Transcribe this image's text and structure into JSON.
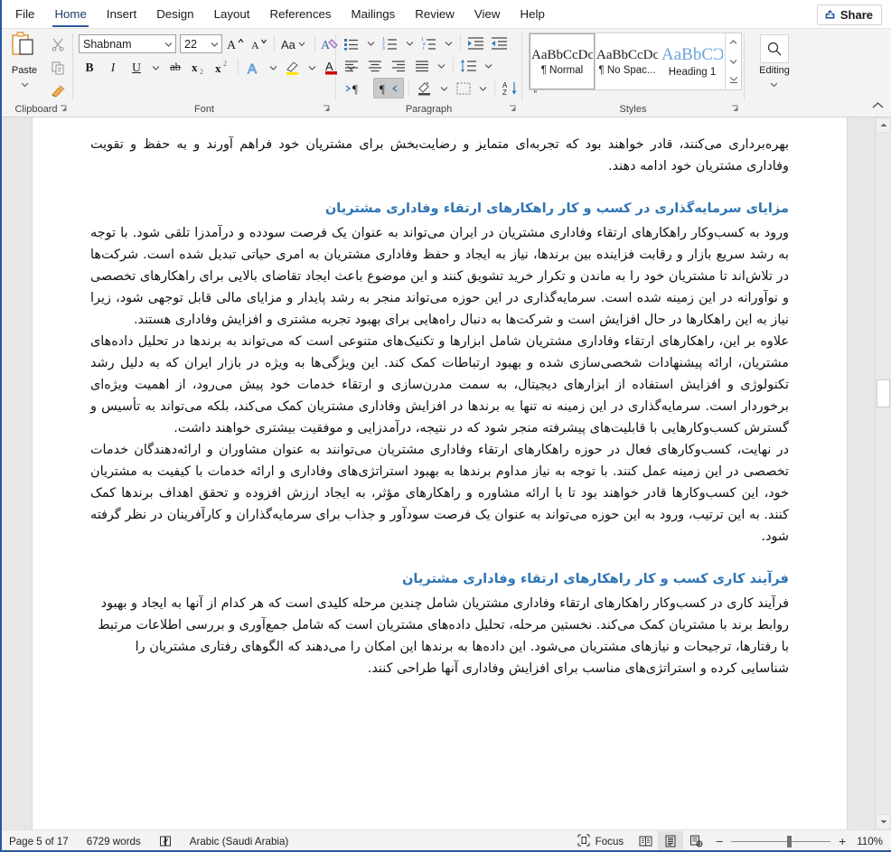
{
  "window": {
    "accent_color": "#2b579a",
    "share_label": "Share"
  },
  "ribbon_tabs": [
    {
      "label": "File",
      "active": false
    },
    {
      "label": "Home",
      "active": true
    },
    {
      "label": "Insert",
      "active": false
    },
    {
      "label": "Design",
      "active": false
    },
    {
      "label": "Layout",
      "active": false
    },
    {
      "label": "References",
      "active": false
    },
    {
      "label": "Mailings",
      "active": false
    },
    {
      "label": "Review",
      "active": false
    },
    {
      "label": "View",
      "active": false
    },
    {
      "label": "Help",
      "active": false
    }
  ],
  "groups": {
    "clipboard": {
      "label": "Clipboard",
      "paste_label": "Paste",
      "items": [
        "paste-icon",
        "cut-scissors-icon",
        "copy-icon",
        "format-painter-icon"
      ]
    },
    "font": {
      "label": "Font",
      "font_name": "Shabnam",
      "font_size": "22",
      "buttons": [
        "grow-font-icon",
        "shrink-font-icon",
        "change-case-icon",
        "clear-formatting-icon",
        "bold-icon",
        "italic-icon",
        "underline-icon",
        "strikethrough-icon",
        "subscript-icon",
        "superscript-icon",
        "text-effects-icon",
        "text-highlight-icon",
        "font-color-icon"
      ],
      "bold_label": "B",
      "italic_label": "I",
      "underline_label": "U",
      "strike_label": "ab",
      "sub_label": "x",
      "sup_label": "x",
      "case_label": "Aa",
      "grow_label": "A",
      "shrink_label": "A",
      "effects_label": "A",
      "color_label": "A"
    },
    "paragraph": {
      "label": "Paragraph",
      "buttons": [
        "bullets-icon",
        "numbering-icon",
        "multilevel-list-icon",
        "decrease-indent-icon",
        "increase-indent-icon",
        "align-left-icon",
        "align-center-icon",
        "align-right-icon",
        "justify-icon",
        "line-spacing-icon",
        "ltr-text-direction-icon",
        "rtl-text-direction-icon",
        "shading-icon",
        "borders-icon",
        "sort-icon",
        "show-formatting-marks-icon"
      ],
      "rtl_active": true
    },
    "styles": {
      "label": "Styles",
      "gallery": [
        {
          "preview": "AaBbCcDc",
          "name": "¶ Normal",
          "selected": true,
          "heading": false
        },
        {
          "preview": "AaBbCcDc",
          "name": "¶ No Spac...",
          "selected": false,
          "heading": false
        },
        {
          "preview": "AaBbCƆ",
          "name": "Heading 1",
          "selected": false,
          "heading": true
        }
      ]
    },
    "editing": {
      "label": "Editing",
      "icon": "search-icon"
    }
  },
  "document": {
    "paragraphs": [
      {
        "type": "body",
        "text": "بهره‌برداری می‌کنند، قادر خواهند بود که تجربه‌ای متمایز و رضایت‌بخش برای مشتریان خود فراهم آورند و به حفظ و تقویت وفاداری مشتریان خود ادامه دهند."
      },
      {
        "type": "heading",
        "text": "مزایای سرمایه‌گذاری در کسب و کار راهکارهای ارتقاء وفاداری مشتریان"
      },
      {
        "type": "body",
        "text": "ورود به کسب‌وکار راهکارهای ارتقاء وفاداری مشتریان در ایران می‌تواند به عنوان یک فرصت سودده و درآمدزا تلقی شود. با توجه به رشد سریع بازار و رقابت فزاینده بین برندها، نیاز به ایجاد و حفظ وفاداری مشتریان به امری حیاتی تبدیل شده است. شرکت‌ها در تلاش‌اند تا مشتریان خود را به ماندن و تکرار خرید تشویق کنند و این موضوع باعث ایجاد تقاضای بالایی برای راهکارهای تخصصی و نوآورانه در این زمینه شده است. سرمایه‌گذاری در این حوزه می‌تواند منجر به رشد پایدار و مزایای مالی قابل توجهی شود، زیرا نیاز به این راهکارها در حال افزایش است و شرکت‌ها به دنبال راه‌هایی برای بهبود تجربه مشتری و افزایش وفاداری هستند."
      },
      {
        "type": "body",
        "text": "علاوه بر این، راهکارهای ارتقاء وفاداری مشتریان شامل ابزارها و تکنیک‌های متنوعی است که می‌تواند به برندها در تحلیل داده‌های مشتریان، ارائه پیشنهادات شخصی‌سازی شده و بهبود ارتباطات کمک کند. این ویژگی‌ها به ویژه در بازار ایران که به دلیل رشد تکنولوژی و افزایش استفاده از ابزارهای دیجیتال، به سمت مدرن‌سازی و ارتقاء خدمات خود پیش می‌رود، از اهمیت ویژه‌ای برخوردار است. سرمایه‌گذاری در این زمینه نه تنها به برندها در افزایش وفاداری مشتریان کمک می‌کند، بلکه می‌تواند به تأسیس و گسترش کسب‌وکارهایی با قابلیت‌های پیشرفته منجر شود که در نتیجه، درآمدزایی و موفقیت بیشتری خواهند داشت."
      },
      {
        "type": "body",
        "text": "در نهایت، کسب‌وکارهای فعال در حوزه راهکارهای ارتقاء وفاداری مشتریان می‌توانند به عنوان مشاوران و ارائه‌دهندگان خدمات تخصصی در این زمینه عمل کنند. با توجه به نیاز مداوم برندها به بهبود استراتژی‌های وفاداری و ارائه خدمات با کیفیت به مشتریان خود، این کسب‌وکارها قادر خواهند بود تا با ارائه مشاوره و راهکارهای مؤثر، به ایجاد ارزش افزوده و تحقق اهداف برندها کمک کنند. به این ترتیب، ورود به این حوزه می‌تواند به عنوان یک فرصت سودآور و جذاب برای سرمایه‌گذاران و کارآفرینان در نظر گرفته شود."
      },
      {
        "type": "heading",
        "text": "فرآیند کاری کسب و کار راهکارهای ارتقاء وفاداری مشتریان"
      },
      {
        "type": "body",
        "text": "فرآیند کاری در کسب‌وکار راهکارهای ارتقاء وفاداری مشتریان شامل چندین مرحله کلیدی است که هر کدام از آنها به ایجاد و بهبود روابط برند با مشتریان کمک می‌کند. نخستین مرحله، تحلیل داده‌های مشتریان است که شامل جمع‌آوری و بررسی اطلاعات مرتبط با رفتارها، ترجیحات و نیازهای مشتریان می‌شود. این داده‌ها به برندها این امکان را می‌دهند که الگوهای رفتاری مشتریان را شناسایی کرده و استراتژی‌های مناسب برای افزایش وفاداری آنها طراحی کنند."
      }
    ],
    "heading_color": "#2e74b5"
  },
  "status_bar": {
    "page": "Page 5 of 17",
    "words": "6729 words",
    "proofing_icon": "proofing-errors-icon",
    "language": "Arabic (Saudi Arabia)",
    "focus_label": "Focus",
    "views": [
      "read-mode-icon",
      "print-layout-icon",
      "web-layout-icon"
    ],
    "zoom_out": "−",
    "zoom_in": "+",
    "zoom_value": "110%"
  }
}
